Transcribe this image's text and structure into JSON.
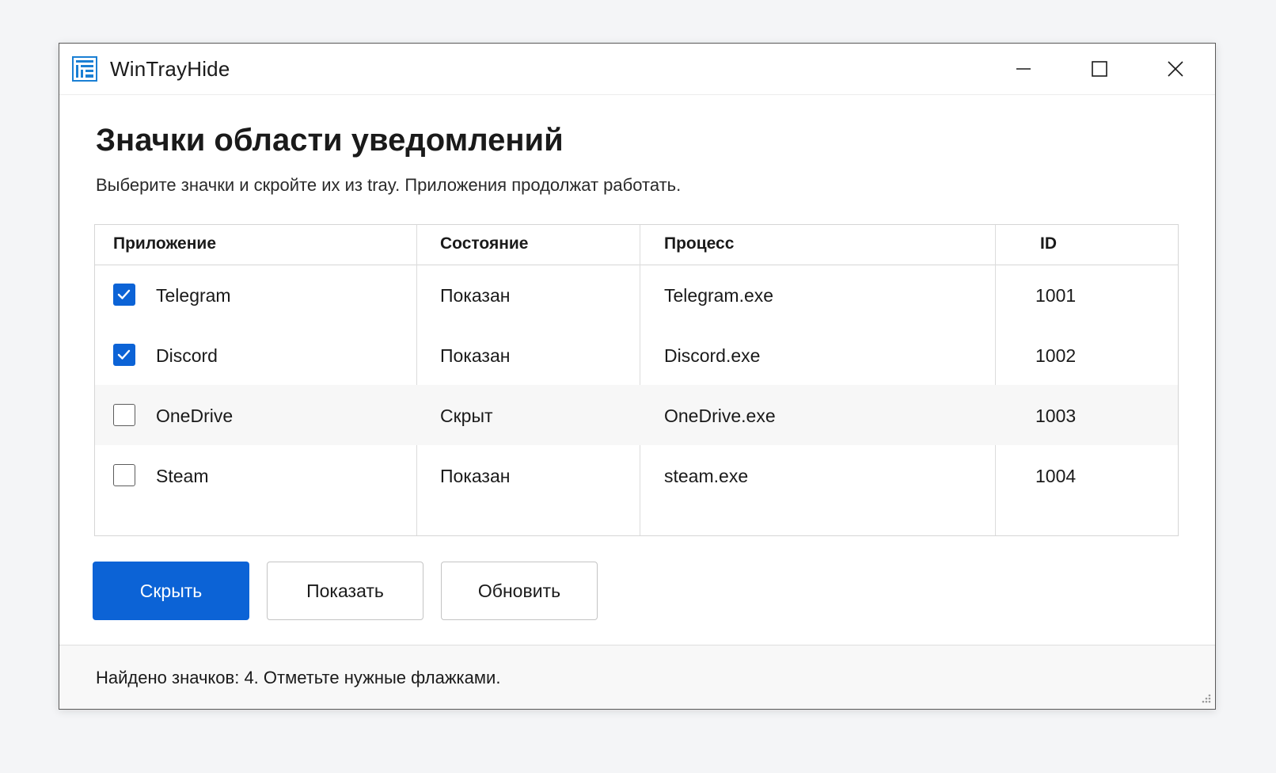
{
  "window": {
    "title": "WinTrayHide",
    "app_icon": "tray-app-icon",
    "controls": {
      "minimize_icon": "minimize-icon",
      "maximize_icon": "maximize-icon",
      "close_icon": "close-icon"
    }
  },
  "main": {
    "heading": "Значки области уведомлений",
    "subheading": "Выберите значки и скройте их из tray. Приложения продолжат работать."
  },
  "table": {
    "columns": [
      "Приложение",
      "Состояние",
      "Процесс",
      "ID"
    ],
    "rows": [
      {
        "app": "Telegram",
        "checked": true,
        "state": "Показан",
        "process": "Telegram.exe",
        "id": "1001"
      },
      {
        "app": "Discord",
        "checked": true,
        "state": "Показан",
        "process": "Discord.exe",
        "id": "1002"
      },
      {
        "app": "OneDrive",
        "checked": false,
        "state": "Скрыт",
        "process": "OneDrive.exe",
        "id": "1003"
      },
      {
        "app": "Steam",
        "checked": false,
        "state": "Показан",
        "process": "steam.exe",
        "id": "1004"
      }
    ]
  },
  "actions": {
    "hide_label": "Скрыть",
    "show_label": "Показать",
    "refresh_label": "Обновить"
  },
  "status": {
    "text": "Найдено значков: 4. Отметьте нужные флажками."
  },
  "colors": {
    "accent": "#0c63d6",
    "alt_row": "#f7f7f7"
  }
}
